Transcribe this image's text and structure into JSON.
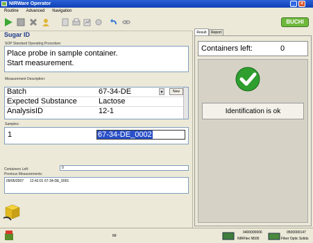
{
  "window": {
    "title": "NIRWare Operator"
  },
  "menu": {
    "items": [
      "Routine",
      "Advanced",
      "Navigation"
    ]
  },
  "brand": {
    "logo_text": "BUCHI",
    "logo_color": "#6fb83b"
  },
  "left": {
    "title": "Sugar ID",
    "sop_label": "SOP Standard Operating Procedure:",
    "sop_line1": "Place probe in sample container.",
    "sop_line2": "Start measurement.",
    "measurement_label": "Measurement Description:",
    "rows": [
      {
        "label": "Batch",
        "value": "67-34-DE"
      },
      {
        "label": "Expected Substance",
        "value": "Lactose"
      },
      {
        "label": "AnalysisID",
        "value": "12-1"
      }
    ],
    "new_button": "New",
    "samples_label": "Samples:",
    "sample_index": "1",
    "sample_value": "67-34-DE_0002",
    "containers_left_label": "Containers Left:",
    "containers_left_value": "0",
    "previous_label": "Previous Measurements:",
    "previous_entry": {
      "date": "09/05/2007",
      "time": "12:42:01",
      "id": "67-34-DE_0001"
    }
  },
  "right": {
    "tabs": [
      "Result",
      "Report"
    ],
    "containers_left_text": "Containers left:",
    "containers_left_value": "0",
    "check_color": "#2e9e2e",
    "identification_button": "Identification is ok"
  },
  "status": {
    "center": "IM",
    "device1_id": "0400000006",
    "device1_name": "NIRFlex N500",
    "device2_id": "0500000147",
    "device2_name": "Fiber Optic Solids"
  }
}
